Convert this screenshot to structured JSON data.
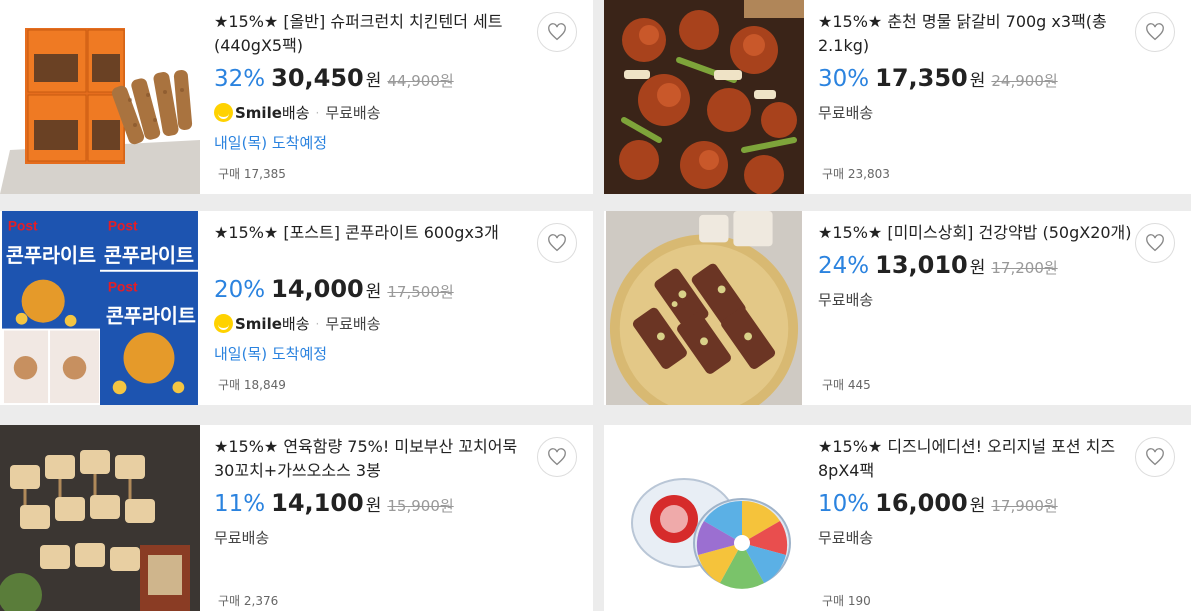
{
  "products": [
    {
      "title": "★15%★ [올반] 슈퍼크런치 치킨텐더 세트(440gX5팩)",
      "discount": "32%",
      "price": "30,450",
      "currency": "원",
      "original_price": "44,900원",
      "smile_badge": "Smile",
      "smile_badge_ko": "배송",
      "shipping": "무료배송",
      "delivery": "내일(목) 도착예정",
      "purchases": "구매 17,385",
      "image_icon": "chicken-tender-package-image"
    },
    {
      "title": "★15%★ 춘천 명물 닭갈비 700g x3팩(총 2.1kg)",
      "discount": "30%",
      "price": "17,350",
      "currency": "원",
      "original_price": "24,900원",
      "shipping": "무료배송",
      "purchases": "구매 23,803",
      "image_icon": "dakgalbi-image"
    },
    {
      "title": "★15%★ [포스트] 콘푸라이트 600gx3개",
      "discount": "20%",
      "price": "14,000",
      "currency": "원",
      "original_price": "17,500원",
      "smile_badge": "Smile",
      "smile_badge_ko": "배송",
      "shipping": "무료배송",
      "delivery": "내일(목) 도착예정",
      "purchases": "구매 18,849",
      "image_icon": "cereal-box-image",
      "image_text": [
        "Post",
        "콘푸라이트",
        "Post",
        "콘푸라이트",
        "Post",
        "콘푸라이트"
      ]
    },
    {
      "title": "★15%★ [미미스상회] 건강약밥 (50gX20개)",
      "discount": "24%",
      "price": "13,010",
      "currency": "원",
      "original_price": "17,200원",
      "shipping": "무료배송",
      "purchases": "구매 445",
      "image_icon": "yakbap-bars-image"
    },
    {
      "title": "★15%★ 연육함량 75%! 미보부산 꼬치어묵 30꼬치+가쓰오소스 3봉",
      "discount": "11%",
      "price": "14,100",
      "currency": "원",
      "original_price": "15,900원",
      "shipping": "무료배송",
      "purchases": "구매 2,376",
      "image_icon": "fishcake-skewers-image"
    },
    {
      "title": "★15%★ 디즈니에디션! 오리지널 포션 치즈 8pX4팩",
      "discount": "10%",
      "price": "16,000",
      "currency": "원",
      "original_price": "17,900원",
      "shipping": "무료배송",
      "purchases": "구매 190",
      "image_icon": "laughing-cow-cheese-image"
    }
  ],
  "colors": {
    "discount": "#2b83df",
    "price": "#222222",
    "smile_yellow": "#ffd200",
    "background": "#ececec"
  },
  "icons": {
    "wishlist": "heart-icon",
    "smile": "smile-delivery-icon"
  }
}
